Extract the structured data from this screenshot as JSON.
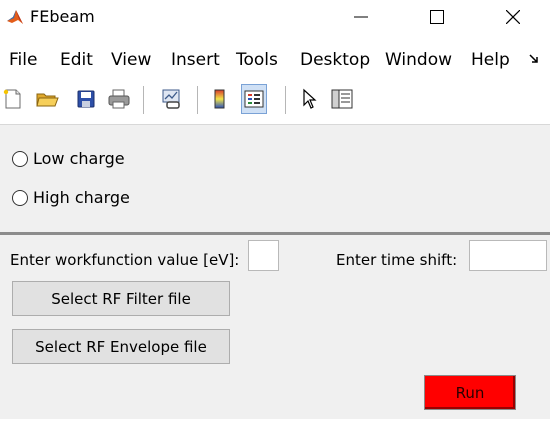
{
  "window": {
    "title": "FEbeam"
  },
  "menu": {
    "items": [
      "File",
      "Edit",
      "View",
      "Insert",
      "Tools",
      "Desktop",
      "Window",
      "Help"
    ]
  },
  "toolbar": {
    "icons": [
      "new-file-icon",
      "open-folder-icon",
      "save-icon",
      "print-icon",
      "link-plot-icon",
      "colorbar-icon",
      "legend-icon",
      "pointer-icon",
      "property-editor-icon"
    ]
  },
  "charge_options": {
    "low": "Low charge",
    "high": "High charge"
  },
  "inputs": {
    "workfunction_label": "Enter workfunction value [eV]:",
    "workfunction_value": "",
    "time_shift_label": "Enter time shift:",
    "time_shift_value": ""
  },
  "buttons": {
    "rf_filter": "Select RF Filter file",
    "rf_envelope": "Select RF Envelope file",
    "run": "Run"
  },
  "colors": {
    "run_button": "#ff0000",
    "panel_background": "#f0f0f0"
  }
}
